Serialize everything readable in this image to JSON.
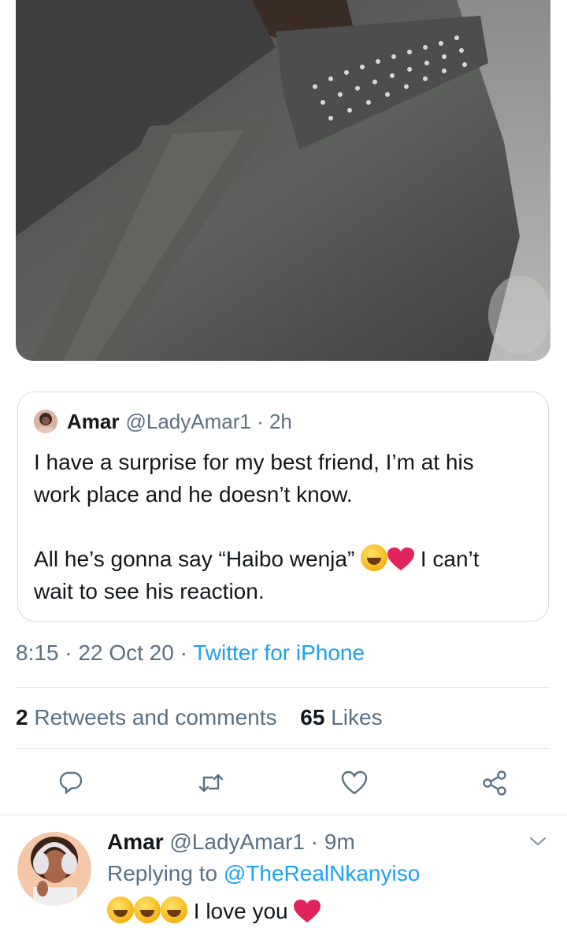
{
  "quoted_tweet": {
    "name": "Amar",
    "handle": "@LadyAmar1",
    "time": "2h",
    "text_line1": "I have a surprise for my best friend, I’m at his work place and he doesn’t know.",
    "text_line2_start": "All he’s gonna say “Haibo wenja”",
    "text_line2_end": "I can’t wait to see his reaction."
  },
  "tweet_meta": {
    "time": "8:15",
    "date": "22 Oct 20",
    "source": "Twitter for iPhone"
  },
  "stats": {
    "retweets_count": "2",
    "retweets_label": "Retweets and comments",
    "likes_count": "65",
    "likes_label": "Likes"
  },
  "actions": [
    "reply-icon",
    "retweet-icon",
    "like-icon",
    "share-icon"
  ],
  "reply": {
    "name": "Amar",
    "handle": "@LadyAmar1",
    "time": "9m",
    "replying_prefix": "Replying to",
    "replying_to": "@TheRealNkanyiso",
    "text": "I love you"
  },
  "colors": {
    "accent": "#1da1f2",
    "secondary_text": "#5b7083",
    "heart": "#e0245e"
  }
}
